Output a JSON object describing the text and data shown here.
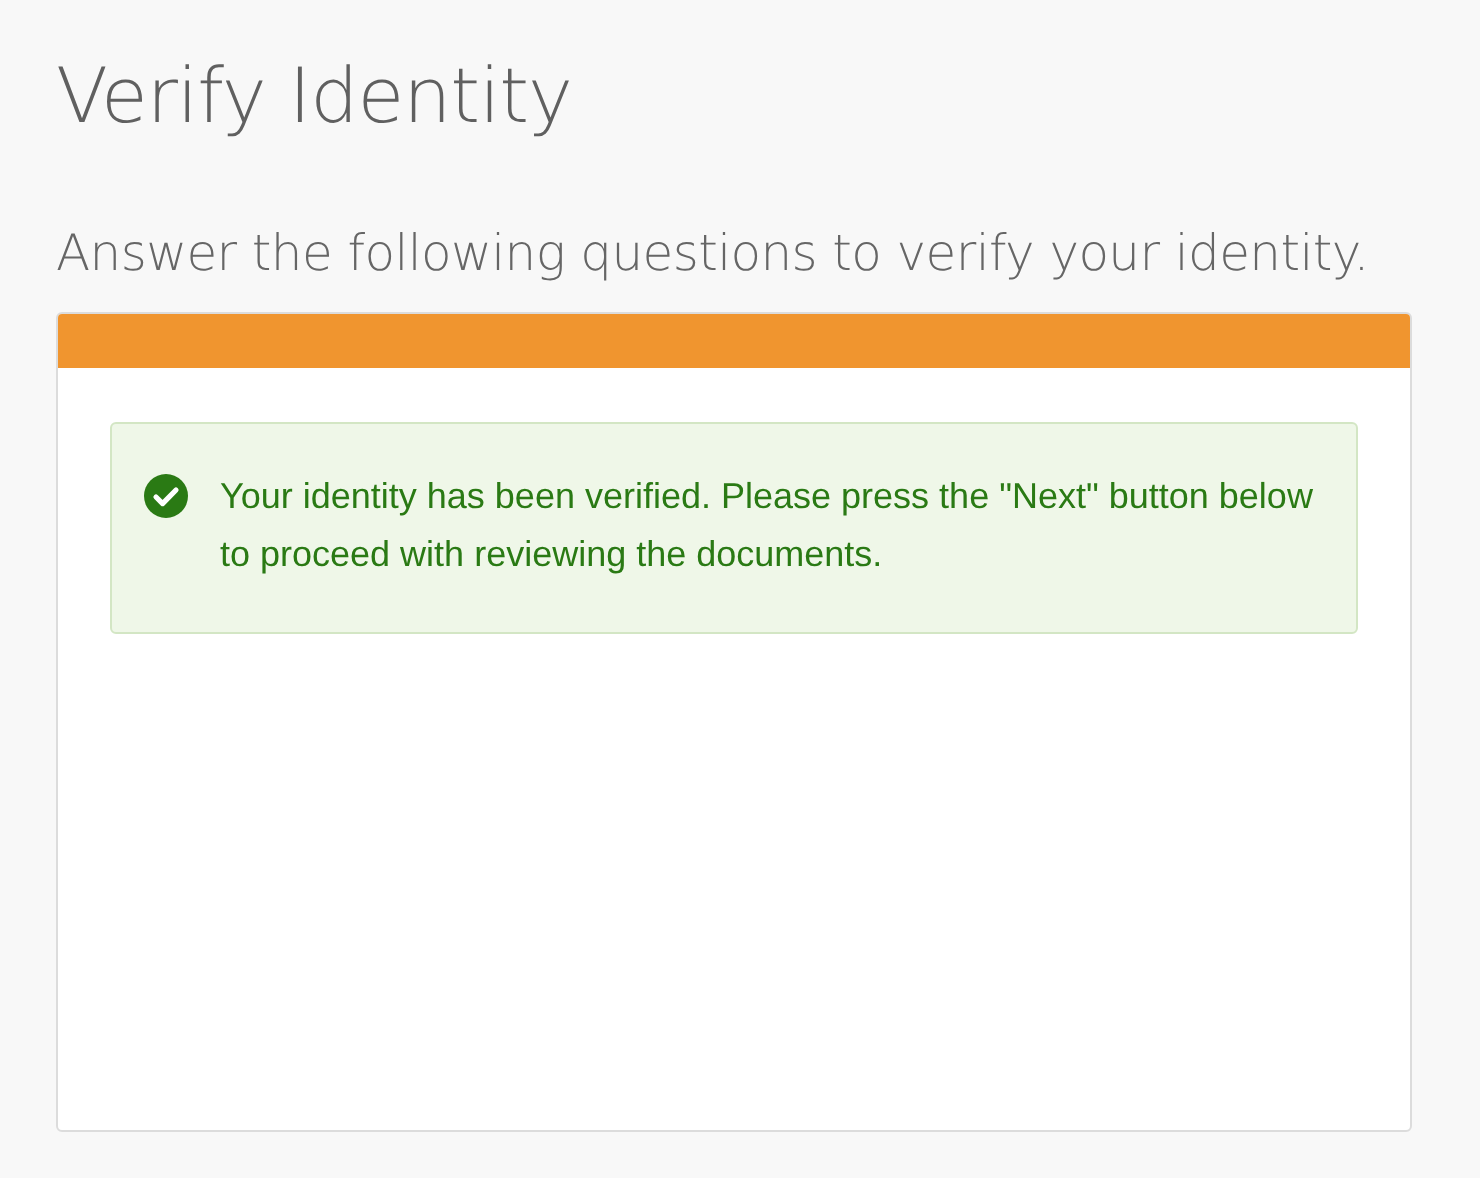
{
  "page": {
    "title": "Verify Identity",
    "subtitle": "Answer the following questions to verify your identity."
  },
  "alert": {
    "kind": "success",
    "message": "Your identity has been verified. Please press the \"Next\" button below to proceed with reviewing the documents."
  }
}
